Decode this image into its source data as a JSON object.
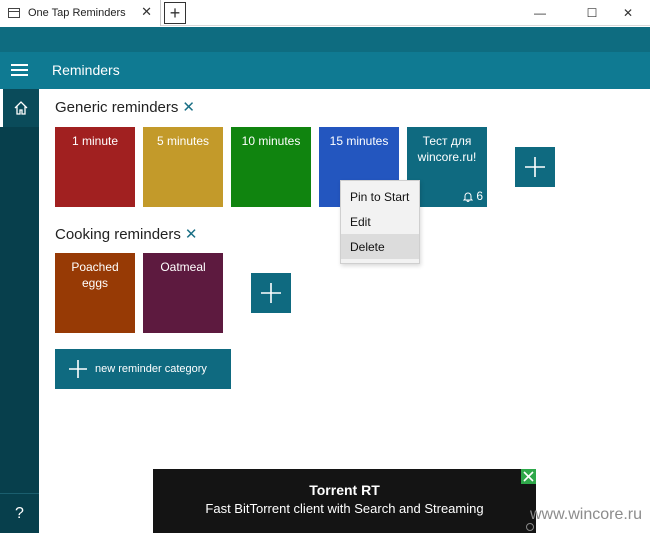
{
  "window": {
    "tab_title": "One Tap Reminders",
    "tab_close": "✕",
    "new_tab": "+",
    "minimize": "—",
    "maximize": "☐",
    "close": "✕"
  },
  "app": {
    "title": "Reminders"
  },
  "categories": [
    {
      "title": "Generic reminders",
      "remove": "✕",
      "tiles": [
        {
          "label": "1 minute",
          "color": "#a12020"
        },
        {
          "label": "5 minutes",
          "color": "#c39a2a"
        },
        {
          "label": "10 minutes",
          "color": "#10840f"
        },
        {
          "label": "15 minutes",
          "color": "#2356bf"
        },
        {
          "label": "Тест для wincore.ru!",
          "color": "#0f6a80",
          "badge_count": "6"
        }
      ]
    },
    {
      "title": "Cooking reminders",
      "remove": "✕",
      "tiles": [
        {
          "label": "Poached eggs",
          "color": "#973a05"
        },
        {
          "label": "Oatmeal",
          "color": "#5d1a3f"
        }
      ]
    }
  ],
  "new_category_label": "new reminder category",
  "context_menu": {
    "items": [
      "Pin to Start",
      "Edit",
      "Delete"
    ]
  },
  "ad": {
    "title": "Torrent RT",
    "subtitle": "Fast BitTorrent client with Search and Streaming"
  },
  "help_label": "?",
  "watermark": "www.wincore.ru",
  "colors": {
    "accent": "#0f7a92",
    "nav": "#073f4c",
    "button": "#0f6a80"
  }
}
